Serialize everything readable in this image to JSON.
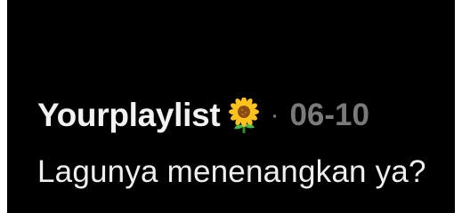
{
  "comment": {
    "username": "Yourplaylist",
    "username_icon": "sunflower-emoji",
    "separator": "·",
    "date": "06-10",
    "text": "Lagunya menenangkan ya?"
  },
  "colors": {
    "background": "#000000",
    "username": "#f2f2f2",
    "meta": "#7a7a7a",
    "text": "#eeeeee"
  }
}
